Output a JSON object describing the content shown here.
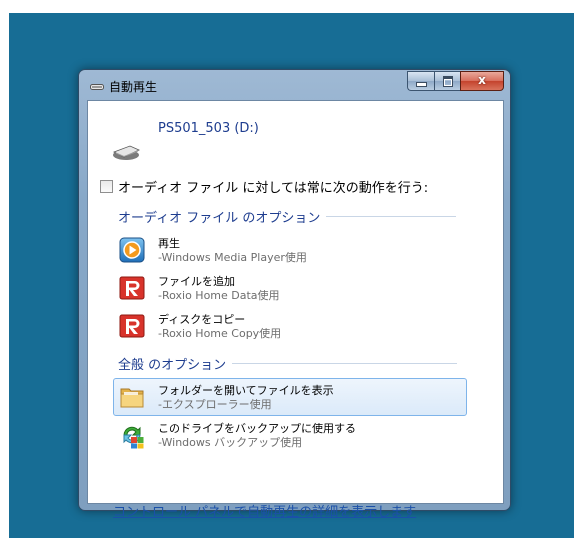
{
  "window": {
    "title": "自動再生",
    "close_label": "x"
  },
  "device": {
    "name": "PS501_503 (D:)"
  },
  "always_checkbox": {
    "label": "オーディオ ファイル に対しては常に次の動作を行う:",
    "checked": false
  },
  "sections": {
    "audio_title": "オーディオ ファイル のオプション",
    "general_title": "全般 のオプション"
  },
  "audio_options": [
    {
      "title": "再生",
      "subtitle": "-Windows Media Player使用",
      "icon": "media-player-icon"
    },
    {
      "title": "ファイルを追加",
      "subtitle": "-Roxio Home Data使用",
      "icon": "roxio-icon"
    },
    {
      "title": "ディスクをコピー",
      "subtitle": "-Roxio Home Copy使用",
      "icon": "roxio-icon"
    }
  ],
  "general_options": [
    {
      "title": "フォルダーを開いてファイルを表示",
      "subtitle": "-エクスプローラー使用",
      "icon": "folder-icon",
      "selected": true
    },
    {
      "title": "このドライブをバックアップに使用する",
      "subtitle": "-Windows バックアップ使用",
      "icon": "backup-icon",
      "selected": false
    }
  ],
  "footer": {
    "link": "コントロール パネルで自動再生の詳細を表示します"
  },
  "colors": {
    "desktop": "#176d95",
    "heading_blue": "#1e3d8f",
    "link_blue": "#1b50a8",
    "close_red": "#c4432d"
  }
}
